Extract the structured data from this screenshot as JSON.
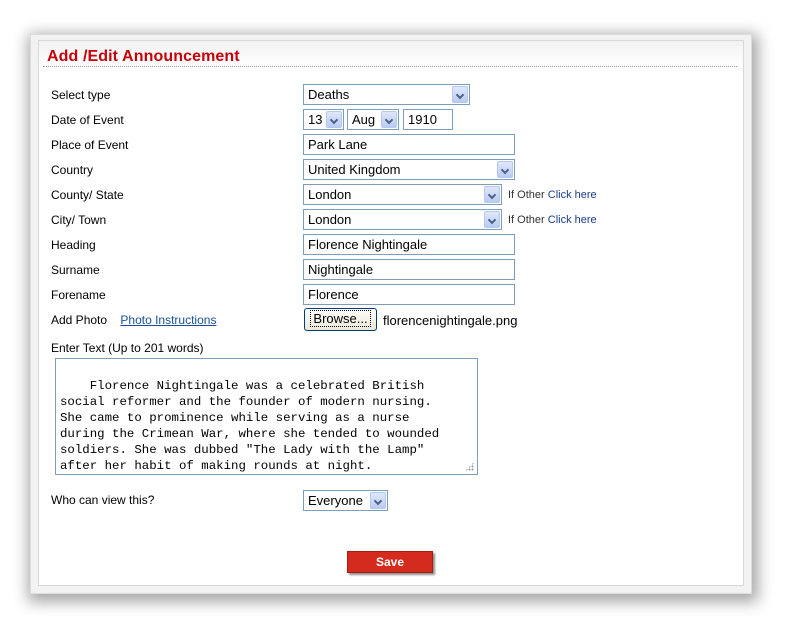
{
  "page": {
    "title": "Add /Edit Announcement"
  },
  "form": {
    "select_type": {
      "label": "Select type",
      "value": "Deaths"
    },
    "date_of_event": {
      "label": "Date of Event",
      "day": "13",
      "month": "Aug",
      "year": "1910"
    },
    "place_of_event": {
      "label": "Place of Event",
      "value": "Park Lane"
    },
    "country": {
      "label": "Country",
      "value": "United Kingdom"
    },
    "county_state": {
      "label": "County/ State",
      "value": "London",
      "other_prefix": "If Other",
      "other_link": "Click here"
    },
    "city_town": {
      "label": "City/ Town",
      "value": "London",
      "other_prefix": "If Other",
      "other_link": "Click here"
    },
    "heading": {
      "label": "Heading",
      "value": "Florence Nightingale"
    },
    "surname": {
      "label": "Surname",
      "value": "Nightingale"
    },
    "forename": {
      "label": "Forename",
      "value": "Florence"
    },
    "add_photo": {
      "label": "Add Photo",
      "instructions_link": "Photo Instructions",
      "browse_label": "Browse...",
      "filename": "florencenightingale.png"
    },
    "enter_text": {
      "label": "Enter Text (Up to 201 words)",
      "value": "Florence Nightingale was a celebrated British\nsocial reformer and the founder of modern nursing.\nShe came to prominence while serving as a nurse\nduring the Crimean War, where she tended to wounded\nsoldiers. She was dubbed \"The Lady with the Lamp\"\nafter her habit of making rounds at night."
    },
    "who_can_view": {
      "label": "Who can view this?",
      "value": "Everyone"
    },
    "save_label": "Save"
  },
  "colors": {
    "title": "#c8000a",
    "save_button": "#d52b1e",
    "link": "#1a4f96"
  }
}
